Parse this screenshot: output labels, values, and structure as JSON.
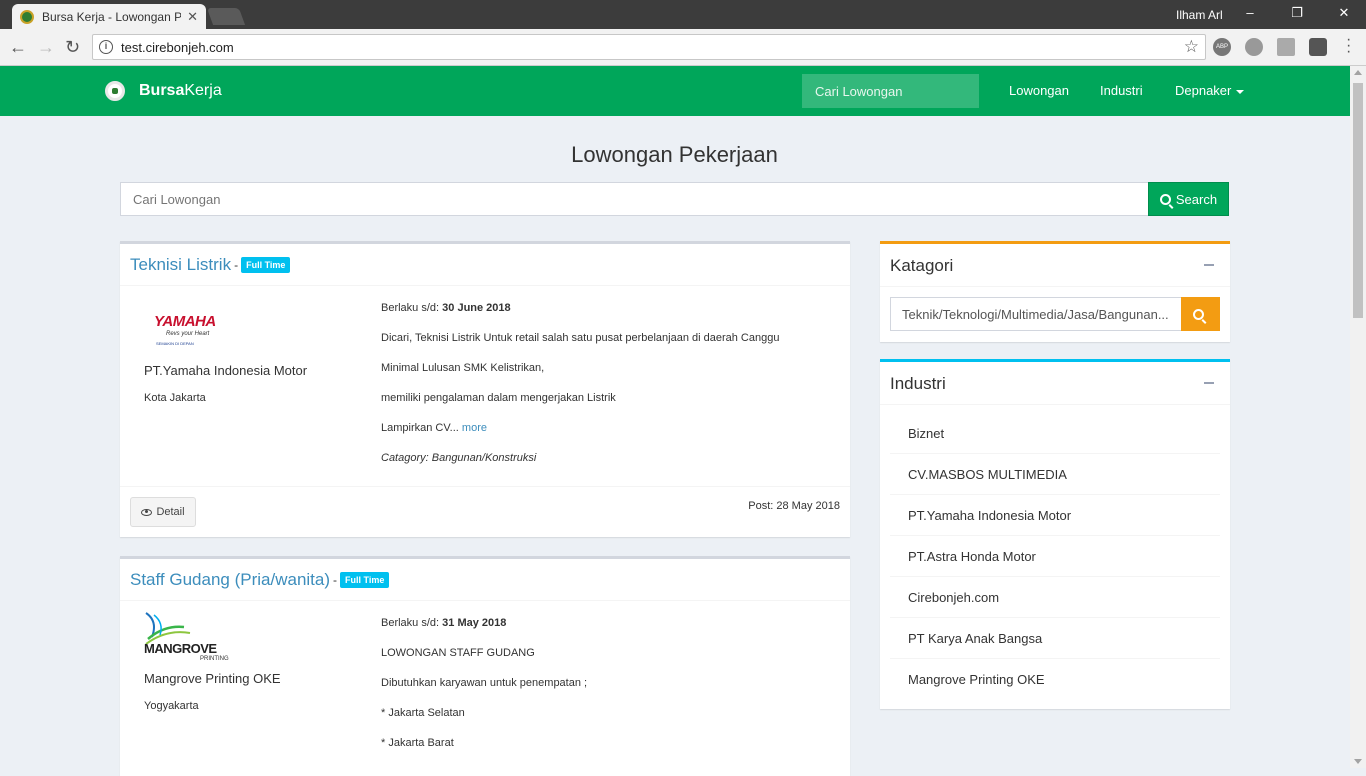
{
  "browser": {
    "tab_title": "Bursa Kerja - Lowongan P",
    "url": "test.cirebonjeh.com",
    "user": "Ilham Arl",
    "extensions": [
      "ABP"
    ]
  },
  "navbar": {
    "brand_bold": "Bursa",
    "brand_rest": "Kerja",
    "search_placeholder": "Cari Lowongan",
    "links": [
      "Lowongan",
      "Industri",
      "Depnaker"
    ]
  },
  "main": {
    "title": "Lowongan Pekerjaan",
    "search_placeholder": "Cari Lowongan",
    "search_button": "Search"
  },
  "jobs": [
    {
      "title": "Teknisi Listrik",
      "badge": "Full Time",
      "logo_text": "YAMAHA",
      "logo_sub": "Revs your Heart",
      "logo_sub2": "SEMAKIN DI DEPAN",
      "company": "PT.Yamaha Indonesia Motor",
      "city": "Kota Jakarta",
      "valid_label": "Berlaku s/d:",
      "valid_date": "30 June 2018",
      "lines": [
        "Dicari, Teknisi Listrik Untuk retail salah satu pusat perbelanjaan di daerah Canggu",
        "Minimal Lulusan SMK Kelistrikan,",
        "memiliki pengalaman dalam mengerjakan Listrik"
      ],
      "last_line": "Lampirkan CV...",
      "more": "more",
      "category": "Catagory: Bangunan/Konstruksi",
      "detail": "Detail",
      "post": "Post: 28 May 2018"
    },
    {
      "title": "Staff Gudang (Pria/wanita)",
      "badge": "Full Time",
      "logo_text": "MANGROVE",
      "logo_sub": "PRINTING",
      "company": "Mangrove Printing OKE",
      "city": "Yogyakarta",
      "valid_label": "Berlaku s/d:",
      "valid_date": "31 May 2018",
      "lines": [
        "LOWONGAN STAFF GUDANG",
        "Dibutuhkan karyawan untuk penempatan ;",
        "* Jakarta Selatan",
        "* Jakarta Barat"
      ]
    }
  ],
  "sidebar": {
    "kategori_title": "Katagori",
    "kategori_value": "Teknik/Teknologi/Multimedia/Jasa/Bangunan...",
    "industri_title": "Industri",
    "industri": [
      "Biznet",
      "CV.MASBOS MULTIMEDIA",
      "PT.Yamaha Indonesia Motor",
      "PT.Astra Honda Motor",
      "Cirebonjeh.com",
      "PT Karya Anak Bangsa",
      "Mangrove Printing OKE"
    ]
  },
  "colors": {
    "navbar": "#00a65a",
    "link": "#3c8dbc",
    "badge": "#00c0ef",
    "kategori_accent": "#f39c12",
    "industri_accent": "#00c0ef"
  }
}
